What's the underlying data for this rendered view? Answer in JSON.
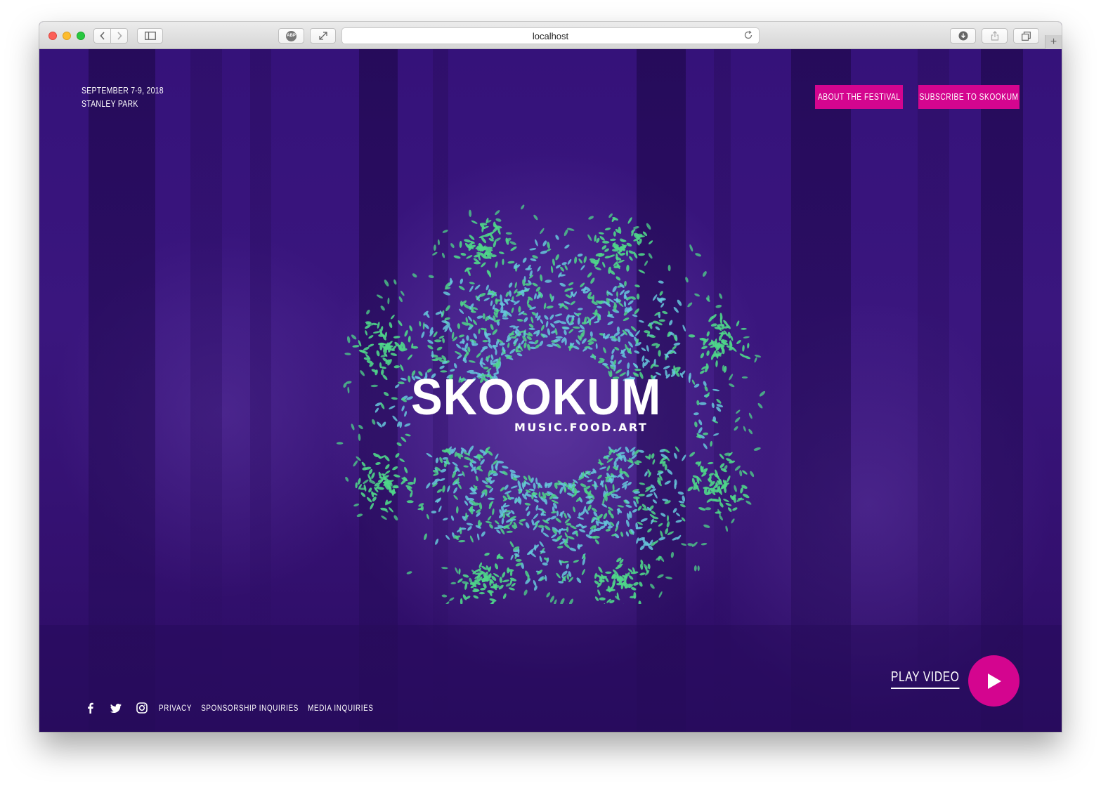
{
  "browser": {
    "url": "localhost",
    "icons": {
      "back": "chevron-left-icon",
      "forward": "chevron-right-icon",
      "sidebar": "sidebar-icon",
      "adblock": "adblock-icon",
      "fullscreen": "expand-icon",
      "reload": "reload-icon",
      "downloads": "download-icon",
      "share": "share-icon",
      "tabs": "tabs-icon",
      "new_tab": "plus-icon"
    },
    "adblock_label": "ABP",
    "new_tab_glyph": "+"
  },
  "header": {
    "date": "SEPTEMBER 7-9, 2018",
    "location": "STANLEY PARK",
    "about_button": "ABOUT THE FESTIVAL",
    "subscribe_button": "SUBSCRIBE TO SKOOKUM"
  },
  "logo": {
    "name": "SKOOKUM",
    "tagline": "MUSIC.FOOD.ART"
  },
  "footer": {
    "social": [
      "facebook-icon",
      "twitter-icon",
      "instagram-icon"
    ],
    "links": [
      "PRIVACY",
      "SPONSORSHIP INQUIRIES",
      "MEDIA INQUIRIES"
    ],
    "play_video": "PLAY VIDEO"
  },
  "colors": {
    "background": "#33106f",
    "accent_pink": "#d4058f",
    "leaf_green": "#4fd68a",
    "leaf_teal": "#66c8dc",
    "text": "#ffffff"
  }
}
